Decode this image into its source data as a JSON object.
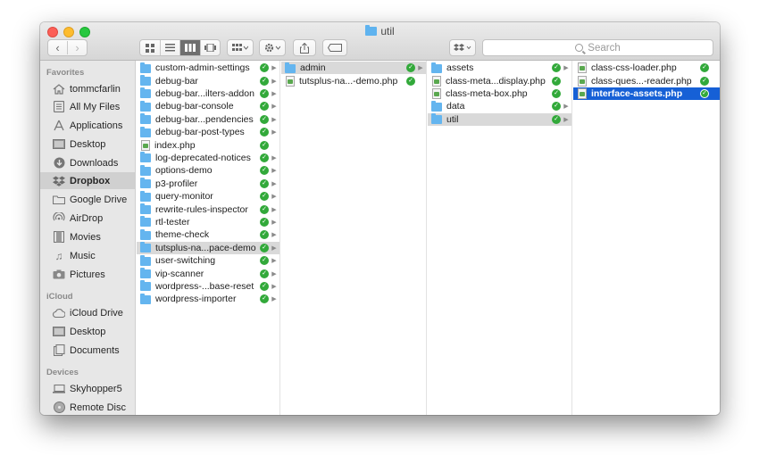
{
  "window": {
    "title": "util"
  },
  "toolbar": {
    "back_glyph": "‹",
    "forward_glyph": "›",
    "search_placeholder": "Search"
  },
  "sidebar": {
    "favorites_header": "Favorites",
    "favorites": [
      {
        "label": "tommcfarlin",
        "icon": "home-icon"
      },
      {
        "label": "All My Files",
        "icon": "all-files-icon"
      },
      {
        "label": "Applications",
        "icon": "applications-icon"
      },
      {
        "label": "Desktop",
        "icon": "desktop-icon"
      },
      {
        "label": "Downloads",
        "icon": "downloads-icon"
      },
      {
        "label": "Dropbox",
        "icon": "dropbox-icon"
      },
      {
        "label": "Google Drive",
        "icon": "folder-icon"
      },
      {
        "label": "AirDrop",
        "icon": "airdrop-icon"
      },
      {
        "label": "Movies",
        "icon": "movies-icon"
      },
      {
        "label": "Music",
        "icon": "music-icon"
      },
      {
        "label": "Pictures",
        "icon": "pictures-icon"
      }
    ],
    "icloud_header": "iCloud",
    "icloud": [
      {
        "label": "iCloud Drive",
        "icon": "cloud-icon"
      },
      {
        "label": "Desktop",
        "icon": "desktop-icon"
      },
      {
        "label": "Documents",
        "icon": "documents-icon"
      }
    ],
    "devices_header": "Devices",
    "devices": [
      {
        "label": "Skyhopper5",
        "icon": "laptop-icon"
      },
      {
        "label": "Remote Disc",
        "icon": "disc-icon"
      }
    ]
  },
  "columns": {
    "col1": [
      "custom-admin-settings",
      "debug-bar",
      "debug-bar...ilters-addon",
      "debug-bar-console",
      "debug-bar...pendencies",
      "debug-bar-post-types",
      "index.php",
      "log-deprecated-notices",
      "options-demo",
      "p3-profiler",
      "query-monitor",
      "rewrite-rules-inspector",
      "rtl-tester",
      "theme-check",
      "tutsplus-na...pace-demo",
      "user-switching",
      "vip-scanner",
      "wordpress-...base-reset",
      "wordpress-importer"
    ],
    "col2": [
      "admin",
      "tutsplus-na...-demo.php"
    ],
    "col3": [
      "assets",
      "class-meta...display.php",
      "class-meta-box.php",
      "data",
      "util"
    ],
    "col4": [
      "class-css-loader.php",
      "class-ques...-reader.php",
      "interface-assets.php"
    ]
  }
}
